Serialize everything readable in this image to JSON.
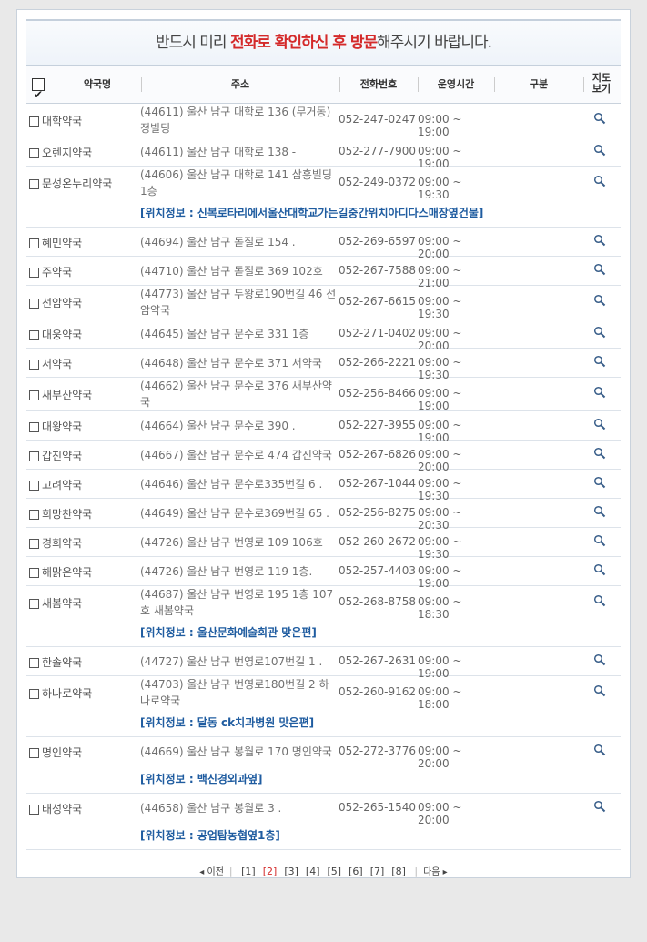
{
  "notice": {
    "part1": "반드시 미리 ",
    "red1": "전화로 확인하신 후 방문",
    "part2": "해주시기 바랍니다."
  },
  "headers": {
    "name": "약국명",
    "address": "주소",
    "phone": "전화번호",
    "hours": "운영시간",
    "category": "구분",
    "map1": "지도",
    "map2": "보기"
  },
  "rows": [
    {
      "name": "대학약국",
      "addr1": "(44611) 울산 남구 대학로 136 (무거동)",
      "addr2": "정빌딩",
      "phone": "052-247-0247",
      "hours": "09:00 ~ 19:00",
      "info": ""
    },
    {
      "name": "오렌지약국",
      "addr1": "(44611) 울산 남구 대학로 138 -",
      "addr2": "",
      "phone": "052-277-7900",
      "hours": "09:00 ~ 19:00",
      "info": ""
    },
    {
      "name": "문성온누리약국",
      "addr1": "(44606) 울산 남구 대학로 141 삼흥빌딩",
      "addr2": "1층",
      "phone": "052-249-0372",
      "hours": "09:00 ~ 19:30",
      "info": "[위치정보 : 신복로타리에서울산대학교가는길중간위치아디다스매장옆건물]"
    },
    {
      "name": "혜민약국",
      "addr1": "(44694) 울산 남구 돋질로 154 .",
      "addr2": "",
      "phone": "052-269-6597",
      "hours": "09:00 ~ 20:00",
      "info": ""
    },
    {
      "name": "주약국",
      "addr1": "(44710) 울산 남구 돋질로 369 102호",
      "addr2": "",
      "phone": "052-267-7588",
      "hours": "09:00 ~ 21:00",
      "info": ""
    },
    {
      "name": "선암약국",
      "addr1": "(44773) 울산 남구 두왕로190번길 46 선",
      "addr2": "암약국",
      "phone": "052-267-6615",
      "hours": "09:00 ~ 19:30",
      "info": ""
    },
    {
      "name": "대웅약국",
      "addr1": "(44645) 울산 남구 문수로 331 1층",
      "addr2": "",
      "phone": "052-271-0402",
      "hours": "09:00 ~ 20:00",
      "info": ""
    },
    {
      "name": "서약국",
      "addr1": "(44648) 울산 남구 문수로 371 서약국",
      "addr2": "",
      "phone": "052-266-2221",
      "hours": "09:00 ~ 19:30",
      "info": ""
    },
    {
      "name": "새부산약국",
      "addr1": "(44662) 울산 남구 문수로 376 새부산약",
      "addr2": "국",
      "phone": "052-256-8466",
      "hours": "09:00 ~ 19:00",
      "info": ""
    },
    {
      "name": "대왕약국",
      "addr1": "(44664) 울산 남구 문수로 390 .",
      "addr2": "",
      "phone": "052-227-3955",
      "hours": "09:00 ~ 19:00",
      "info": ""
    },
    {
      "name": "갑진약국",
      "addr1": "(44667) 울산 남구 문수로 474 갑진약국",
      "addr2": "",
      "phone": "052-267-6826",
      "hours": "09:00 ~ 20:00",
      "info": ""
    },
    {
      "name": "고려약국",
      "addr1": "(44646) 울산 남구 문수로335번길 6 .",
      "addr2": "",
      "phone": "052-267-1044",
      "hours": "09:00 ~ 19:30",
      "info": ""
    },
    {
      "name": "희망찬약국",
      "addr1": "(44649) 울산 남구 문수로369번길 65 .",
      "addr2": "",
      "phone": "052-256-8275",
      "hours": "09:00 ~ 20:30",
      "info": ""
    },
    {
      "name": "경희약국",
      "addr1": "(44726) 울산 남구 번영로 109 106호",
      "addr2": "",
      "phone": "052-260-2672",
      "hours": "09:00 ~ 19:30",
      "info": ""
    },
    {
      "name": "해맑은약국",
      "addr1": "(44726) 울산 남구 번영로 119 1층.",
      "addr2": "",
      "phone": "052-257-4403",
      "hours": "09:00 ~ 19:00",
      "info": ""
    },
    {
      "name": "새봄약국",
      "addr1": "(44687) 울산 남구 번영로 195 1층 107",
      "addr2": "호 새봄약국",
      "phone": "052-268-8758",
      "hours": "09:00 ~ 18:30",
      "info": "[위치정보 : 울산문화예술회관 맞은편]"
    },
    {
      "name": "한솔약국",
      "addr1": "(44727) 울산 남구 번영로107번길 1 .",
      "addr2": "",
      "phone": "052-267-2631",
      "hours": "09:00 ~ 19:00",
      "info": ""
    },
    {
      "name": "하나로약국",
      "addr1": "(44703) 울산 남구 번영로180번길 2 하",
      "addr2": "나로약국",
      "phone": "052-260-9162",
      "hours": "09:00 ~ 18:00",
      "info": "[위치정보 : 달동 ck치과병원 맞은편]"
    },
    {
      "name": "명인약국",
      "addr1": "(44669) 울산 남구 봉월로 170 명인약국",
      "addr2": "",
      "phone": "052-272-3776",
      "hours": "09:00 ~ 20:00",
      "info": "[위치정보 : 백신경외과옆]"
    },
    {
      "name": "태성약국",
      "addr1": "(44658) 울산 남구 봉월로 3 .",
      "addr2": "",
      "phone": "052-265-1540",
      "hours": "09:00 ~ 20:00",
      "info": "[위치정보 : 공업탑농협옆1층]"
    }
  ],
  "pager": {
    "prev": "이전",
    "next": "다음",
    "pages": [
      "[1]",
      "[2]",
      "[3]",
      "[4]",
      "[5]",
      "[6]",
      "[7]",
      "[8]"
    ],
    "current_index": 1
  },
  "colors": {
    "accent_red": "#d42a2a",
    "info_blue": "#1f5ca0"
  }
}
